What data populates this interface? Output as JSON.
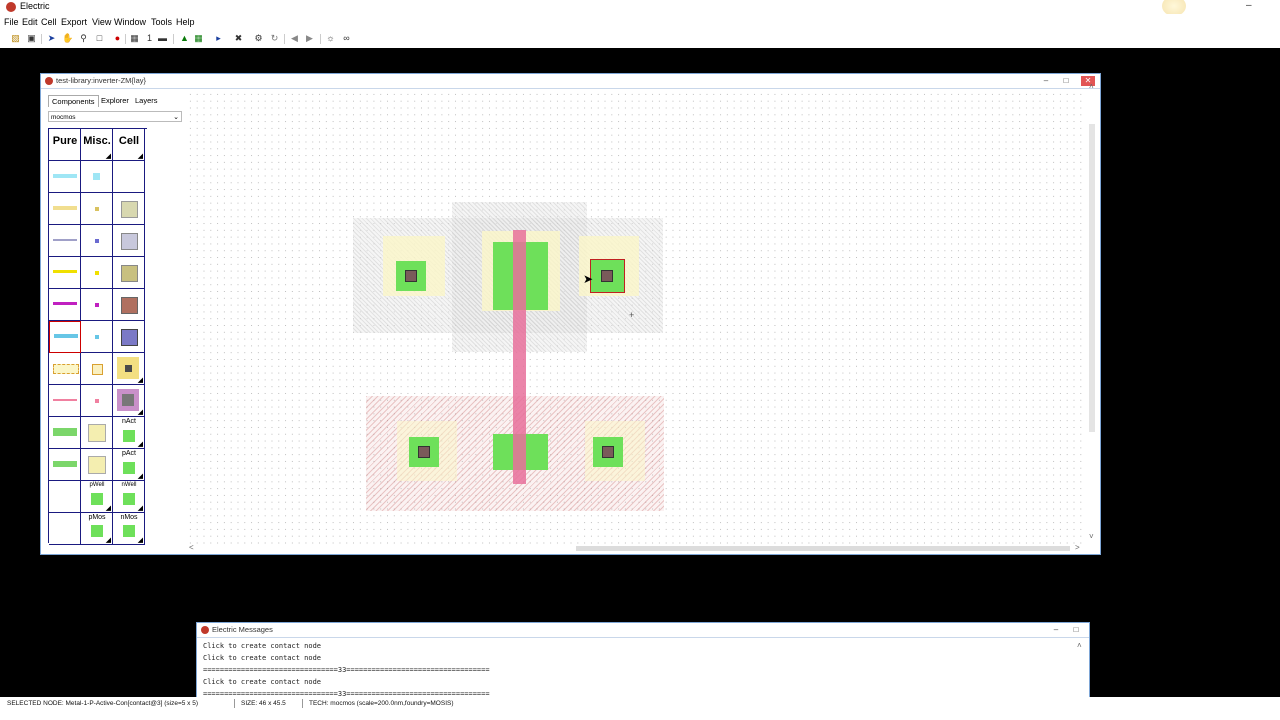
{
  "app": {
    "title": "Electric",
    "menus": [
      "File",
      "Edit",
      "Cell",
      "Export",
      "View",
      "Window",
      "Tools",
      "Help"
    ],
    "toolbar_icons": [
      "open-icon",
      "save-icon",
      "select-icon",
      "pan-icon",
      "zoom-icon",
      "zoom-fit-icon",
      "record-icon",
      "grid-icon",
      "measure-icon",
      "toggle-icon",
      "layout-icon",
      "select-mode-icon",
      "tool-icon",
      "settings-icon",
      "undo-icon",
      "back-icon",
      "forward-icon",
      "view-icon",
      "link-icon"
    ],
    "toolbar_text_1": "1"
  },
  "edit_window": {
    "title": "test-library:inverter-ZM{lay}",
    "tabs": [
      "Components",
      "Explorer",
      "Layers"
    ],
    "technology": "mocmos",
    "palette_headers": [
      "Pure",
      "Misc.",
      "Cell"
    ],
    "palette_labels": [
      "nAct",
      "pAct",
      "pWell",
      "nWell",
      "pMos",
      "nMos"
    ]
  },
  "messages": {
    "title": "Electric Messages",
    "lines": [
      "Click to create contact node",
      "Click to create contact node",
      "================================33==================================",
      "Click to create contact node",
      "================================33=================================="
    ]
  },
  "statusbar": {
    "selected": "SELECTED NODE: Metal-1-P-Active-Con[contact@3] (size=5 x 5)",
    "size": "SIZE: 46 x 45.5",
    "tech": "TECH: mocmos (scale=200.0nm,foundry=MOSIS)"
  },
  "colors": {
    "active": "#6ee05a",
    "poly": "#e8709b",
    "metal1": "#8aa3e0",
    "well": "#c86e6e",
    "select": "#f5ec9a"
  }
}
